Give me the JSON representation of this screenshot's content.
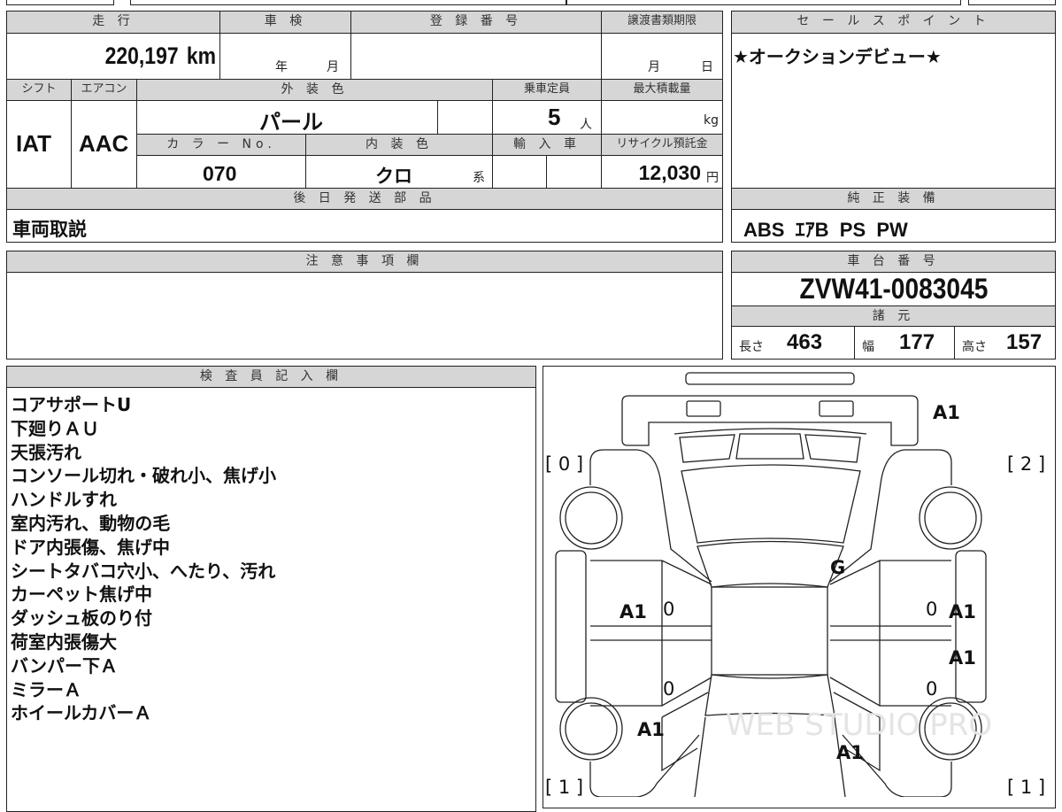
{
  "odometer": {
    "label": "走 行",
    "value": "220,197",
    "unit": "km"
  },
  "inspection": {
    "label": "車 検",
    "year_unit": "年",
    "month_unit": "月"
  },
  "registration": {
    "label": "登 録 番 号",
    "value": ""
  },
  "transfer_deadline": {
    "label": "譲渡書類期限",
    "month_unit": "月",
    "day_unit": "日"
  },
  "shift": {
    "label": "シフト",
    "value": "IAT"
  },
  "aircon": {
    "label": "エアコン",
    "value": "AAC"
  },
  "exterior_color": {
    "label": "外 装 色",
    "value": "パール"
  },
  "capacity": {
    "label": "乗車定員",
    "value": "5",
    "unit": "人"
  },
  "max_load": {
    "label": "最大積載量",
    "unit": "kg"
  },
  "color_no": {
    "label": "カ ラ ー No.",
    "value": "070"
  },
  "interior_color": {
    "label": "内 装 色",
    "value": "クロ",
    "unit": "系"
  },
  "imported": {
    "label": "輸 入 車"
  },
  "recycle_fee": {
    "label": "リサイクル預託金",
    "value": "12,030",
    "unit": "円"
  },
  "later_parts": {
    "label": "後 日 発 送 部 品",
    "value": "車両取説"
  },
  "sales_point": {
    "label": "セ ー ル ス ポ イ ン ト",
    "value": "★オークションデビュー★"
  },
  "genuine_equipment": {
    "label": "純 正 装 備",
    "value": "ABS  ｴｱB  PS  PW"
  },
  "caution": {
    "label": "注 意 事 項 欄",
    "value": ""
  },
  "chassis_number": {
    "label": "車 台 番 号",
    "value": "ZVW41-0083045"
  },
  "specs": {
    "label": "諸 元",
    "length_label": "長さ",
    "length": "463",
    "width_label": "幅",
    "width": "177",
    "height_label": "高さ",
    "height": "157"
  },
  "inspector": {
    "label": "検 査 員 記 入 欄",
    "notes": [
      "コアサポートU",
      "下廻りＡＵ",
      "天張汚れ",
      "コンソール切れ・破れ小、焦げ小",
      "ハンドルすれ",
      "室内汚れ、動物の毛",
      "ドア内張傷、焦げ中",
      "シートタバコ穴小、へたり、汚れ",
      "カーペット焦げ中",
      "ダッシュ板のり付",
      "荷室内張傷大",
      "バンパー下Ａ",
      "ミラーＡ",
      "ホイールカバーＡ"
    ]
  },
  "diagram": {
    "rear_bumper": "A1",
    "tire_rear_left": "[ 0 ]",
    "tire_rear_right": "[ 2 ]",
    "tire_front_left": "[ 1 ]",
    "tire_front_right": "[ 1 ]",
    "roof": "G",
    "left_rear_door": "A1",
    "left_rear_door_mark": "0",
    "left_front_door_mark": "0",
    "right_rear_door_mark": "0",
    "right_front_door_mark": "0",
    "right_rear_door": "A1",
    "right_front_door": "A1",
    "left_front_fender": "A1",
    "hood": "A1",
    "watermark": "WEB STUDIO PRO"
  }
}
